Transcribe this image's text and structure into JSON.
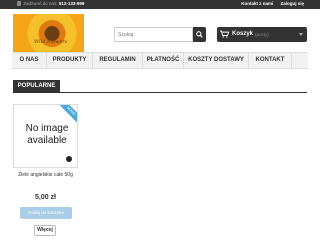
{
  "topbar": {
    "phone_prefix": "Zadzwoń do nas:",
    "phone": "512-133-999",
    "links": [
      "Kontakt z nami",
      "Zaloguj się"
    ]
  },
  "logo": {
    "text": "Wild Flowers"
  },
  "search": {
    "placeholder": "Szukaj"
  },
  "cart": {
    "label": "Koszyk",
    "status": "(pusty)"
  },
  "nav": {
    "items": [
      "O NAS",
      "PRODUKTY",
      "REGULAMIN",
      "PŁATNOŚĆ",
      "KOSZTY DOSTAWY",
      "KONTAKT"
    ]
  },
  "section": {
    "title": "POPULARNE"
  },
  "product": {
    "image_text": "No image available",
    "badge": "NOWE",
    "name": "Ziele angielskie całe 50g",
    "price": "5,00 zł",
    "add_label": "Dodaj do koszyka",
    "more_label": "Więcej"
  },
  "colors": {
    "accent": "#333333",
    "button_disabled": "#a9cde6",
    "ribbon": "#4aa8d8"
  }
}
